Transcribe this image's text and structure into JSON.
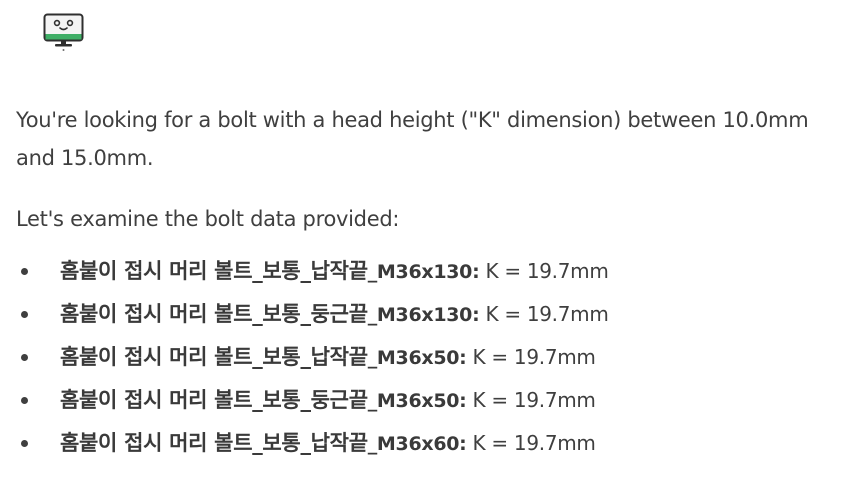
{
  "avatar": {
    "icon": "computer-monitor-face-icon",
    "stroke_color": "#2f2f2f",
    "screen_color": "#f4f4f4",
    "accent_color": "#3fae66"
  },
  "message": {
    "intro": "You're looking for a bolt with a head height (\"K\" dimension) between 10.0mm and 15.0mm.",
    "lead": "Let's examine the bolt data provided:",
    "bolts": [
      {
        "name": "홈붙이 접시 머리 볼트_보통_납작끝",
        "size": "_M36x130:",
        "value": " K = 19.7mm"
      },
      {
        "name": "홈붙이 접시 머리 볼트_보통_둥근끝",
        "size": "_M36x130:",
        "value": " K = 19.7mm"
      },
      {
        "name": "홈붙이 접시 머리 볼트_보통_납작끝",
        "size": "_M36x50:",
        "value": " K = 19.7mm"
      },
      {
        "name": "홈붙이 접시 머리 볼트_보통_둥근끝",
        "size": "_M36x50:",
        "value": " K = 19.7mm"
      },
      {
        "name": "홈붙이 접시 머리 볼트_보통_납작끝",
        "size": "_M36x60:",
        "value": " K = 19.7mm"
      }
    ]
  }
}
